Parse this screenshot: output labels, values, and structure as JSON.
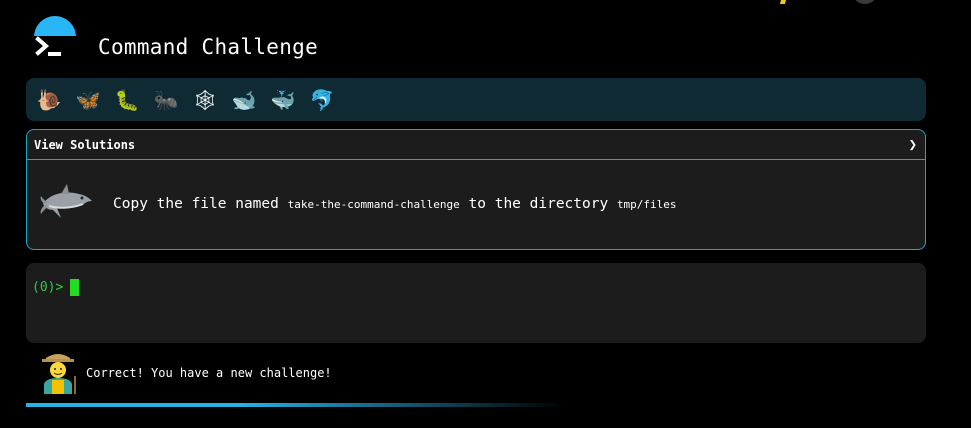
{
  "header": {
    "title": "Command Challenge",
    "logo_icon": "terminal-prompt-icon"
  },
  "levels": [
    {
      "name": "snail-icon",
      "glyph": "🐌"
    },
    {
      "name": "butterfly-icon",
      "glyph": "🦋"
    },
    {
      "name": "caterpillar-icon",
      "glyph": "🐛"
    },
    {
      "name": "ant-icon",
      "glyph": "🐜"
    },
    {
      "name": "spider-web-icon",
      "glyph": "🕸"
    },
    {
      "name": "whale-icon",
      "glyph": "🐋"
    },
    {
      "name": "spouting-whale-icon",
      "glyph": "🐳"
    },
    {
      "name": "dolphin-icon",
      "glyph": "🐬"
    }
  ],
  "challenge": {
    "view_solutions_label": "View Solutions",
    "expand_chevron": "❯",
    "text_before": "Copy the file named ",
    "file_name": "take-the-command-challenge",
    "text_middle": " to the directory ",
    "dir_name": "tmp/files"
  },
  "terminal": {
    "prompt": "(0)>"
  },
  "feedback": {
    "message": "Correct! You have a new challenge!"
  },
  "colors": {
    "accent": "#1fa3c7",
    "panel_bg": "#1c1c1c",
    "levels_bg": "#0f2a33",
    "prompt_green": "#2ecc40",
    "cursor_green": "#22dd22"
  }
}
